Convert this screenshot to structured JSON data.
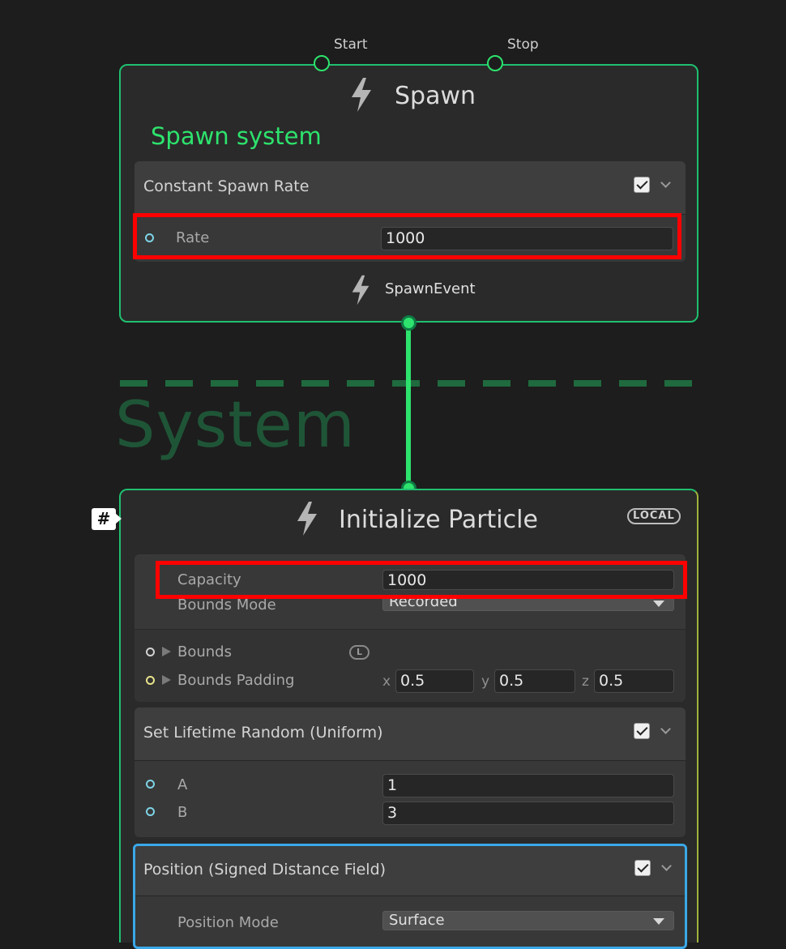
{
  "spawn_node": {
    "title": "Spawn",
    "subtitle": "Spawn system",
    "inputs": [
      "Start",
      "Stop"
    ],
    "block": {
      "title": "Constant Spawn Rate",
      "enabled": true,
      "rate_label": "Rate",
      "rate_value": "1000"
    },
    "output_label": "SpawnEvent"
  },
  "system": {
    "title": "System",
    "border_color": "#1f6a3e"
  },
  "init_node": {
    "title": "Initialize Particle",
    "space_badge": "LOCAL",
    "settings_icon": "#",
    "capacity_label": "Capacity",
    "capacity_value": "1000",
    "bounds_mode_label": "Bounds Mode",
    "bounds_mode_value": "Recorded",
    "bounds_label": "Bounds",
    "bounds_space_badge": "L",
    "bounds_padding_label": "Bounds Padding",
    "bounds_padding": {
      "x": "0.5",
      "y": "0.5",
      "z": "0.5"
    },
    "axis_labels": {
      "x": "x",
      "y": "y",
      "z": "z"
    },
    "lifetime_block": {
      "title": "Set Lifetime Random (Uniform)",
      "enabled": true,
      "a_label": "A",
      "a_value": "1",
      "b_label": "B",
      "b_value": "3"
    },
    "position_block": {
      "title": "Position (Signed Distance Field)",
      "enabled": true,
      "selected": true,
      "mode_label": "Position Mode",
      "mode_value": "Surface"
    }
  },
  "colors": {
    "node_border": "#1fbf6f",
    "accent_green": "#2de36d",
    "highlight": "#ff0000",
    "selection": "#3aa8e8"
  }
}
